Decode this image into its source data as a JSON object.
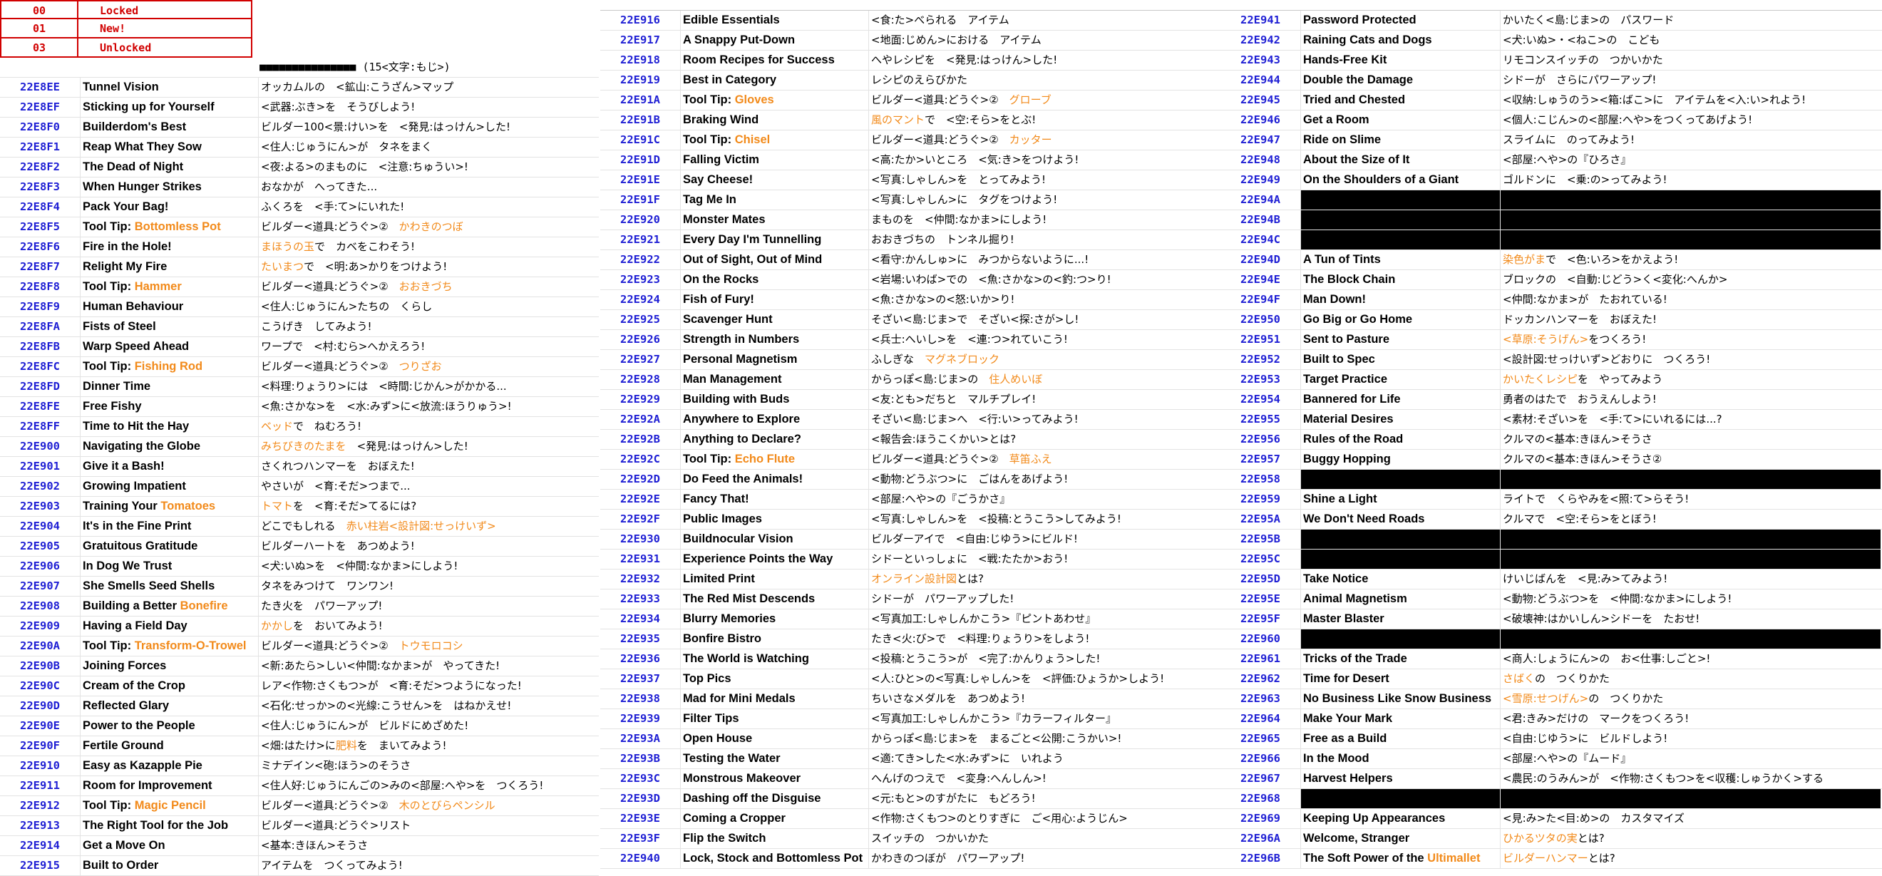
{
  "legend": [
    {
      "code": "00",
      "label": "Locked"
    },
    {
      "code": "01",
      "label": "New!"
    },
    {
      "code": "03",
      "label": "Unlocked"
    }
  ],
  "header_row": {
    "desc": "■■■■■■■■■■■■■■■ (15<文字:もじ>)"
  },
  "colA": [
    {
      "id": "22E8EE",
      "name": "Tunnel Vision",
      "desc": "オッカムルの　<鉱山:こうざん>マップ"
    },
    {
      "id": "22E8EF",
      "name": "Sticking up for Yourself",
      "desc": "<武器:ぶき>を　そうびしよう!"
    },
    {
      "id": "22E8F0",
      "name": "Builderdom's Best",
      "desc": "ビルダー100<景:けい>を　<発見:はっけん>した!"
    },
    {
      "id": "22E8F1",
      "name": "Reap What They Sow",
      "desc": "<住人:じゅうにん>が　タネをまく"
    },
    {
      "id": "22E8F2",
      "name": "The Dead of Night",
      "desc": "<夜:よる>のまものに　<注意:ちゅうい>!"
    },
    {
      "id": "22E8F3",
      "name": "When Hunger Strikes",
      "desc": "おなかが　へってきた..."
    },
    {
      "id": "22E8F4",
      "name": "Pack Your Bag!",
      "desc": "ふくろを　<手:て>にいれた!"
    },
    {
      "id": "22E8F5",
      "name": "Tool Tip: ",
      "name_o": "Bottomless Pot",
      "desc": "ビルダー<道具:どうぐ>②　",
      "desc_o": "かわきのつぼ"
    },
    {
      "id": "22E8F6",
      "name": "Fire in the Hole!",
      "desc_o_pre": "まほうの玉",
      "desc": "で　カベをこわそう!"
    },
    {
      "id": "22E8F7",
      "name": "Relight My Fire",
      "desc_o_pre": "たいまつ",
      "desc": "で　<明:あ>かりをつけよう!"
    },
    {
      "id": "22E8F8",
      "name": "Tool Tip: ",
      "name_o": "Hammer",
      "desc": "ビルダー<道具:どうぐ>②　",
      "desc_o": "おおきづち"
    },
    {
      "id": "22E8F9",
      "name": "Human Behaviour",
      "desc": "<住人:じゅうにん>たちの　くらし"
    },
    {
      "id": "22E8FA",
      "name": "Fists of Steel",
      "desc": "こうげき　してみよう!"
    },
    {
      "id": "22E8FB",
      "name": "Warp Speed Ahead",
      "desc": "ワープで　<村:むら>へかえろう!"
    },
    {
      "id": "22E8FC",
      "name": "Tool Tip: ",
      "name_o": "Fishing Rod",
      "desc": "ビルダー<道具:どうぐ>②　",
      "desc_o": "つりざお"
    },
    {
      "id": "22E8FD",
      "name": "Dinner Time",
      "desc": "<料理:りょうり>には　<時間:じかん>がかかる..."
    },
    {
      "id": "22E8FE",
      "name": "Free Fishy",
      "desc": "<魚:さかな>を　<水:みず>に<放流:ほうりゅう>!"
    },
    {
      "id": "22E8FF",
      "name": "Time to Hit the Hay",
      "desc_o_pre": "ベッド",
      "desc": "で　ねむろう!"
    },
    {
      "id": "22E900",
      "name": "Navigating the Globe",
      "desc_o_pre": "みちびきのたまを",
      "desc": "　<発見:はっけん>した!"
    },
    {
      "id": "22E901",
      "name": "Give it a Bash!",
      "desc": "さくれつハンマーを　おぼえた!"
    },
    {
      "id": "22E902",
      "name": "Growing Impatient",
      "desc": "やさいが　<育:そだ>つまで..."
    },
    {
      "id": "22E903",
      "name": "Training Your ",
      "name_o": "Tomatoes",
      "desc_o_pre": "トマト",
      "desc": "を　<育:そだ>てるには?"
    },
    {
      "id": "22E904",
      "name": "It's in the Fine Print",
      "desc": "どこでもしれる　",
      "desc_o": "赤い柱岩<設計図:せっけいず>"
    },
    {
      "id": "22E905",
      "name": "Gratuitous Gratitude",
      "desc": "ビルダーハートを　あつめよう!"
    },
    {
      "id": "22E906",
      "name": "In Dog We Trust",
      "desc": "<犬:いぬ>を　<仲間:なかま>にしよう!"
    },
    {
      "id": "22E907",
      "name": "She Smells Seed Shells",
      "desc": "タネをみつけて　ワンワン!"
    },
    {
      "id": "22E908",
      "name": "Building a Better ",
      "name_o": "Bonefire",
      "desc": "たき火を　パワーアップ!"
    },
    {
      "id": "22E909",
      "name": "Having a Field Day",
      "desc_o_pre": "かかし",
      "desc": "を　おいてみよう!"
    },
    {
      "id": "22E90A",
      "name": "Tool Tip: ",
      "name_o": "Transform-O-Trowel",
      "desc": "ビルダー<道具:どうぐ>②　",
      "desc_o": "トウモロコシ"
    },
    {
      "id": "22E90B",
      "name": "Joining Forces",
      "desc": "<新:あたら>しい<仲間:なかま>が　やってきた!"
    },
    {
      "id": "22E90C",
      "name": "Cream of the Crop",
      "desc": "レア<作物:さくもつ>が　<育:そだ>つようになった!"
    },
    {
      "id": "22E90D",
      "name": "Reflected Glary",
      "desc": "<石化:せっか>の<光線:こうせん>を　はねかえせ!"
    },
    {
      "id": "22E90E",
      "name": "Power to the People",
      "desc": "<住人:じゅうにん>が　ビルドにめざめた!"
    },
    {
      "id": "22E90F",
      "name": "Fertile Ground",
      "desc": "<畑:はたけ>に",
      "desc_o": "肥料",
      "desc2": "を　まいてみよう!"
    },
    {
      "id": "22E910",
      "name": "Easy as Kazapple Pie",
      "desc": "ミナデイン<砲:ほう>のそうさ"
    },
    {
      "id": "22E911",
      "name": "Room for Improvement",
      "desc": "<住人好:じゅうにんごの>みの<部屋:へや>を　つくろう!"
    },
    {
      "id": "22E912",
      "name": "Tool Tip: ",
      "name_o": "Magic Pencil",
      "desc": "ビルダー<道具:どうぐ>②　",
      "desc_o": "木のとびらペンシル"
    },
    {
      "id": "22E913",
      "name": "The Right Tool for the Job",
      "desc": "ビルダー<道具:どうぐ>リスト"
    },
    {
      "id": "22E914",
      "name": "Get a Move On",
      "desc": "<基本:きほん>そうさ"
    },
    {
      "id": "22E915",
      "name": "Built to Order",
      "desc": "アイテムを　つくってみよう!"
    }
  ],
  "colB": [
    {
      "id": "22E916",
      "name": "Edible Essentials",
      "desc": "<食:た>べられる　アイテム"
    },
    {
      "id": "22E917",
      "name": "A Snappy Put-Down",
      "desc": "<地面:じめん>における　アイテム"
    },
    {
      "id": "22E918",
      "name": "Room Recipes for Success",
      "desc": "へやレシピを　<発見:はっけん>した!"
    },
    {
      "id": "22E919",
      "name": "Best in Category",
      "desc": "レシピのえらびかた"
    },
    {
      "id": "22E91A",
      "name": "Tool Tip: ",
      "name_o": "Gloves",
      "desc": "ビルダー<道具:どうぐ>②　",
      "desc_o": "グローブ"
    },
    {
      "id": "22E91B",
      "name": "Braking Wind",
      "desc_o_pre": "風のマント",
      "desc": "で　<空:そら>をとぶ!"
    },
    {
      "id": "22E91C",
      "name": "Tool Tip: ",
      "name_o": "Chisel",
      "desc": "ビルダー<道具:どうぐ>②　",
      "desc_o": "カッター"
    },
    {
      "id": "22E91D",
      "name": "Falling Victim",
      "desc": "<高:たか>いところ　<気:き>をつけよう!"
    },
    {
      "id": "22E91E",
      "name": "Say Cheese!",
      "desc": "<写真:しゃしん>を　とってみよう!"
    },
    {
      "id": "22E91F",
      "name": "Tag Me In",
      "desc": "<写真:しゃしん>に　タグをつけよう!"
    },
    {
      "id": "22E920",
      "name": "Monster Mates",
      "desc": "まものを　<仲間:なかま>にしよう!"
    },
    {
      "id": "22E921",
      "name": "Every Day I'm Tunnelling",
      "desc": "おおきづちの　トンネル掘り!"
    },
    {
      "id": "22E922",
      "name": "Out of Sight, Out of Mind",
      "desc": "<看守:かんしゅ>に　みつからないように...!"
    },
    {
      "id": "22E923",
      "name": "On the Rocks",
      "desc": "<岩場:いわば>での　<魚:さかな>の<釣:つ>り!"
    },
    {
      "id": "22E924",
      "name": "Fish of Fury!",
      "desc": "<魚:さかな>の<怒:いか>り!"
    },
    {
      "id": "22E925",
      "name": "Scavenger Hunt",
      "desc": "そざい<島:じま>で　そざい<探:さが>し!"
    },
    {
      "id": "22E926",
      "name": "Strength in Numbers",
      "desc": "<兵士:へいし>を　<連:つ>れていこう!"
    },
    {
      "id": "22E927",
      "name": "Personal Magnetism",
      "desc": "ふしぎな　",
      "desc_o": "マグネブロック"
    },
    {
      "id": "22E928",
      "name": "Man Management",
      "desc": "からっぽ<島:じま>の　",
      "desc_o": "住人めいぼ"
    },
    {
      "id": "22E929",
      "name": "Building with Buds",
      "desc": "<友:とも>だちと　マルチプレイ!"
    },
    {
      "id": "22E92A",
      "name": "Anywhere to Explore",
      "desc": "そざい<島:じま>へ　<行:い>ってみよう!"
    },
    {
      "id": "22E92B",
      "name": "Anything to Declare?",
      "desc": "<報告会:ほうこくかい>とは?"
    },
    {
      "id": "22E92C",
      "name": "Tool Tip: ",
      "name_o": "Echo Flute",
      "desc": "ビルダー<道具:どうぐ>②　",
      "desc_o": "草笛ふえ"
    },
    {
      "id": "22E92D",
      "name": "Do Feed the Animals!",
      "desc": "<動物:どうぶつ>に　ごはんをあげよう!"
    },
    {
      "id": "22E92E",
      "name": "Fancy That!",
      "desc": "<部屋:へや>の『ごうかさ』"
    },
    {
      "id": "22E92F",
      "name": "Public Images",
      "desc": "<写真:しゃしん>を　<投稿:とうこう>してみよう!"
    },
    {
      "id": "22E930",
      "name": "Buildnocular Vision",
      "desc": "ビルダーアイで　<自由:じゆう>にビルド!"
    },
    {
      "id": "22E931",
      "name": "Experience Points the Way",
      "desc": "シドーといっしょに　<戦:たたか>おう!"
    },
    {
      "id": "22E932",
      "name": "Limited Print",
      "desc_o_pre": "オンライン設計図",
      "desc": "とは?"
    },
    {
      "id": "22E933",
      "name": "The Red Mist Descends",
      "desc": "シドーが　パワーアップした!"
    },
    {
      "id": "22E934",
      "name": "Blurry Memories",
      "desc": "<写真加工:しゃしんかこう>『ピントあわせ』"
    },
    {
      "id": "22E935",
      "name": "Bonfire Bistro",
      "desc": "たき<火:び>で　<料理:りょうり>をしよう!"
    },
    {
      "id": "22E936",
      "name": "The World is Watching",
      "desc": "<投稿:とうこう>が　<完了:かんりょう>した!"
    },
    {
      "id": "22E937",
      "name": "Top Pics",
      "desc": "<人:ひと>の<写真:しゃしん>を　<評価:ひょうか>しよう!"
    },
    {
      "id": "22E938",
      "name": "Mad for Mini Medals",
      "desc": "ちいさなメダルを　あつめよう!"
    },
    {
      "id": "22E939",
      "name": "Filter Tips",
      "desc": "<写真加工:しゃしんかこう>『カラーフィルター』"
    },
    {
      "id": "22E93A",
      "name": "Open House",
      "desc": "からっぽ<島:じま>を　まるごと<公開:こうかい>!"
    },
    {
      "id": "22E93B",
      "name": "Testing the Water",
      "desc": "<適:てき>した<水:みず>に　いれよう"
    },
    {
      "id": "22E93C",
      "name": "Monstrous Makeover",
      "desc": "へんげのつえで　<変身:へんしん>!"
    },
    {
      "id": "22E93D",
      "name": "Dashing off the Disguise",
      "desc": "<元:もと>のすがたに　もどろう!"
    },
    {
      "id": "22E93E",
      "name": "Coming a Cropper",
      "desc": "<作物:さくもつ>のとりすぎに　ご<用心:ようじん>"
    },
    {
      "id": "22E93F",
      "name": "Flip the Switch",
      "desc": "スイッチの　つかいかた"
    },
    {
      "id": "22E940",
      "name": "Lock, Stock and Bottomless Pot",
      "desc": "かわきのつぼが　パワーアップ!"
    }
  ],
  "colC": [
    {
      "id": "22E941",
      "name": "Password Protected",
      "desc": "かいたく<島:じま>の　パスワード"
    },
    {
      "id": "22E942",
      "name": "Raining Cats and Dogs",
      "desc": "<犬:いぬ>・<ねこ>の　こども"
    },
    {
      "id": "22E943",
      "name": "Hands-Free Kit",
      "desc": "リモコンスイッチの　つかいかた"
    },
    {
      "id": "22E944",
      "name": "Double the Damage",
      "desc": "シドーが　さらにパワーアップ!"
    },
    {
      "id": "22E945",
      "name": "Tried and Chested",
      "desc": "<収納:しゅうのう><箱:ばこ>に　アイテムを<入:い>れよう!"
    },
    {
      "id": "22E946",
      "name": "Get a Room",
      "desc": "<個人:こじん>の<部屋:へや>をつくってあげよう!"
    },
    {
      "id": "22E947",
      "name": "Ride on Slime",
      "desc": "スライムに　のってみよう!"
    },
    {
      "id": "22E948",
      "name": "About the Size of It",
      "desc": "<部屋:へや>の『ひろさ』"
    },
    {
      "id": "22E949",
      "name": "On the Shoulders of a Giant",
      "desc": "ゴルドンに　<乗:の>ってみよう!"
    },
    {
      "id": "22E94A",
      "name": "",
      "desc": "",
      "black": true
    },
    {
      "id": "22E94B",
      "name": "",
      "desc": "",
      "black": true
    },
    {
      "id": "22E94C",
      "name": "",
      "desc": "",
      "black": true
    },
    {
      "id": "22E94D",
      "name": "A Tun of Tints",
      "desc_o_pre": "染色がま",
      "desc": "で　<色:いろ>をかえよう!"
    },
    {
      "id": "22E94E",
      "name": "The Block Chain",
      "desc": "ブロックの　<自動:じどう>く<変化:へんか>"
    },
    {
      "id": "22E94F",
      "name": "Man Down!",
      "desc": "<仲間:なかま>が　たおれている!"
    },
    {
      "id": "22E950",
      "name": "Go Big or Go Home",
      "desc": "ドッカンハンマーを　おぼえた!"
    },
    {
      "id": "22E951",
      "name": "Sent to Pasture",
      "desc_o_pre": "<草原:そうげん>",
      "desc": "をつくろう!"
    },
    {
      "id": "22E952",
      "name": "Built to Spec",
      "desc": "<設計図:せっけいず>どおりに　つくろう!"
    },
    {
      "id": "22E953",
      "name": "Target Practice",
      "desc_o_pre": "かいたくレシピ",
      "desc": "を　やってみよう"
    },
    {
      "id": "22E954",
      "name": "Bannered for Life",
      "desc": "勇者のはたで　おうえんしよう!"
    },
    {
      "id": "22E955",
      "name": "Material Desires",
      "desc": "<素材:そざい>を　<手:て>にいれるには...?"
    },
    {
      "id": "22E956",
      "name": "Rules of the Road",
      "desc": "クルマの<基本:きほん>そうさ"
    },
    {
      "id": "22E957",
      "name": "Buggy Hopping",
      "desc": "クルマの<基本:きほん>そうさ②"
    },
    {
      "id": "22E958",
      "name": "",
      "desc": "",
      "black": true
    },
    {
      "id": "22E959",
      "name": "Shine a Light",
      "desc": "ライトで　くらやみを<照:て>らそう!"
    },
    {
      "id": "22E95A",
      "name": "We Don't Need Roads",
      "desc": "クルマで　<空:そら>をとぼう!"
    },
    {
      "id": "22E95B",
      "name": "",
      "desc": "",
      "black": true
    },
    {
      "id": "22E95C",
      "name": "",
      "desc": "",
      "black": true
    },
    {
      "id": "22E95D",
      "name": "Take Notice",
      "desc": "けいじばんを　<見:み>てみよう!"
    },
    {
      "id": "22E95E",
      "name": "Animal Magnetism",
      "desc": "<動物:どうぶつ>を　<仲間:なかま>にしよう!"
    },
    {
      "id": "22E95F",
      "name": "Master Blaster",
      "desc": "<破壊神:はかいしん>シドーを　たおせ!"
    },
    {
      "id": "22E960",
      "name": "",
      "desc": "",
      "black": true
    },
    {
      "id": "22E961",
      "name": "Tricks of the Trade",
      "desc": "<商人:しょうにん>の　お<仕事:しごと>!"
    },
    {
      "id": "22E962",
      "name": "Time for Desert",
      "desc_o_pre": "さばく",
      "desc": "の　つくりかた"
    },
    {
      "id": "22E963",
      "name": "No Business Like Snow Business",
      "desc_o_pre": "<雪原:せつげん>",
      "desc": "の　つくりかた"
    },
    {
      "id": "22E964",
      "name": "Make Your Mark",
      "desc": "<君:きみ>だけの　マークをつくろう!"
    },
    {
      "id": "22E965",
      "name": "Free as a Build",
      "desc": "<自由:じゆう>に　ビルドしよう!"
    },
    {
      "id": "22E966",
      "name": "In the Mood",
      "desc": "<部屋:へや>の『ムード』"
    },
    {
      "id": "22E967",
      "name": "Harvest Helpers",
      "desc": "<農民:のうみん>が　<作物:さくもつ>を<収穫:しゅうかく>する"
    },
    {
      "id": "22E968",
      "name": "",
      "desc": "",
      "black": true
    },
    {
      "id": "22E969",
      "name": "Keeping Up Appearances",
      "desc": "<見:み>た<目:め>の　カスタマイズ"
    },
    {
      "id": "22E96A",
      "name": "Welcome, Stranger",
      "desc_o_pre": "ひかるツタの実",
      "desc": "とは?"
    },
    {
      "id": "22E96B",
      "name": "The Soft Power of the ",
      "name_o": "Ultimallet",
      "desc_o_pre": "ビルダーハンマー",
      "desc": "とは?"
    }
  ]
}
